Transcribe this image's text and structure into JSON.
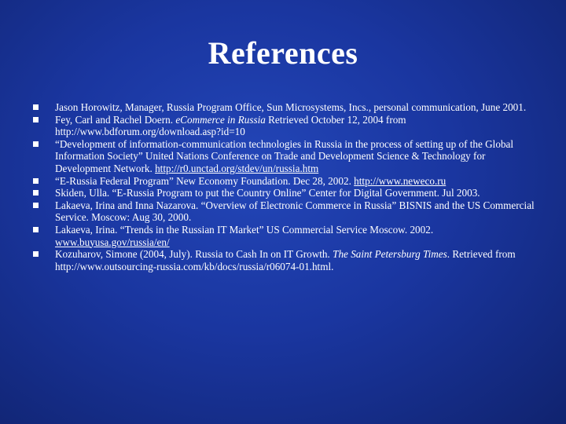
{
  "slide": {
    "title": "References",
    "references": [
      {
        "parts": [
          {
            "t": "Jason Horowitz, Manager, Russia Program Office, Sun Microsystems, Incs., personal communication, June 2001."
          }
        ]
      },
      {
        "parts": [
          {
            "t": "Fey, Carl and Rachel Doern. "
          },
          {
            "t": "eCommerce in Russia",
            "i": true
          },
          {
            "t": " Retrieved October 12, 2004 from http://www.bdforum.org/download.asp?id=10"
          }
        ]
      },
      {
        "parts": [
          {
            "t": "“Development of information-communication technologies in Russia in the process of setting up of the Global Information Society” United Nations Conference on Trade and Development Science & Technology for Development Network. "
          },
          {
            "t": "http://r0.unctad.org/stdev/un/russia.htm",
            "link": true
          }
        ]
      },
      {
        "parts": [
          {
            "t": " “E-Russia Federal Program” New Economy Foundation. Dec 28, 2002. "
          },
          {
            "t": "http://www.neweco.ru",
            "link": true
          }
        ]
      },
      {
        "parts": [
          {
            "t": "Skiden, Ulla. “E-Russia Program to put the Country Online” Center for Digital Government. Jul 2003."
          }
        ]
      },
      {
        "parts": [
          {
            "t": "Lakaeva, Irina and Inna Nazarova. “Overview of Electronic Commerce in Russia” BISNIS and the US Commercial Service. Moscow: Aug 30, 2000."
          }
        ]
      },
      {
        "parts": [
          {
            "t": "Lakaeva, Irina. “Trends in the Russian IT Market” US Commercial Service Moscow. 2002. "
          },
          {
            "t": "www.buyusa.gov/russia/en/",
            "link": true
          }
        ]
      },
      {
        "parts": [
          {
            "t": "Kozuharov, Simone (2004, July). Russia to Cash In on IT Growth. "
          },
          {
            "t": "The Saint Petersburg Times",
            "i": true
          },
          {
            "t": ". Retrieved from http://www.outsourcing-russia.com/kb/docs/russia/r06074-01.html."
          }
        ]
      }
    ]
  }
}
